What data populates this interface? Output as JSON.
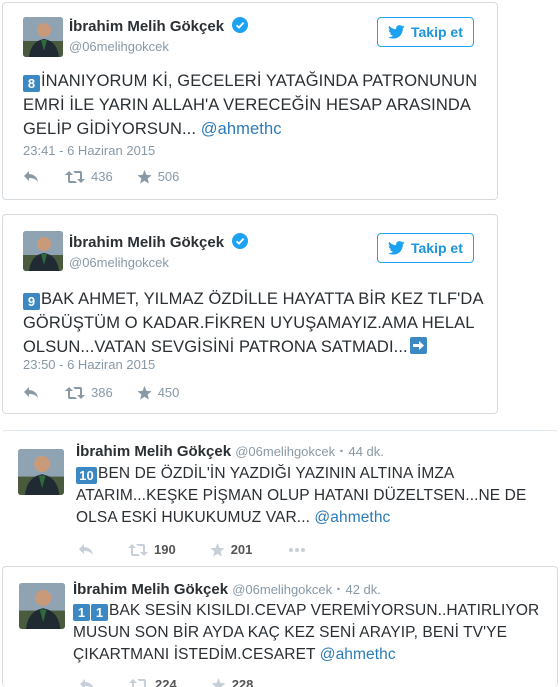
{
  "tweets": [
    {
      "name": "İbrahim Melih Gökçek",
      "handle": "@06melihgokcek",
      "follow_label": "Takip et",
      "keycap": "8",
      "text": "İNANIYORUM Kİ, GECELERİ YATAĞINDA PATRONUNUN EMRİ İLE YARIN ALLAH'A VERECEĞİN HESAP ARASINDA GELİP GİDİYORSUN... ",
      "mention": "@ahmethc",
      "timestamp": "23:41 - 6 Haziran 2015",
      "retweets": "436",
      "favorites": "506"
    },
    {
      "name": "İbrahim Melih Gökçek",
      "handle": "@06melihgokcek",
      "follow_label": "Takip et",
      "keycap": "9",
      "text": "BAK AHMET, YILMAZ ÖZDİLLE HAYATTA BİR KEZ TLF'DA GÖRÜŞTÜM O KADAR.FİKREN UYUŞAMAYIZ.AMA HELAL OLSUN...VATAN SEVGİSİNİ PATRONA SATMADI...",
      "timestamp": "23:50 - 6 Haziran 2015",
      "retweets": "386",
      "favorites": "450"
    },
    {
      "name": "İbrahim Melih Gökçek",
      "handle": "@06melihgokcek",
      "time_ago": "44 dk.",
      "keycap": "10",
      "text": "BEN DE ÖZDİL'İN YAZDIĞI YAZININ ALTINA İMZA ATARIM...KEŞKE PİŞMAN OLUP HATANI DÜZELTSEN...NE DE OLSA ESKİ HUKUKUMUZ VAR... ",
      "mention": "@ahmethc",
      "retweets": "190",
      "favorites": "201"
    },
    {
      "name": "İbrahim Melih Gökçek",
      "handle": "@06melihgokcek",
      "time_ago": "42 dk.",
      "keycap_a": "1",
      "keycap_b": "1",
      "text": "BAK SESİN KISILDI.CEVAP VEREMİYORSUN..HATIRLIYOR MUSUN SON BİR AYDA KAÇ KEZ SENİ ARAYIP, BENİ TV'YE ÇIKARTMANI İSTEDİM.CESARET ",
      "mention": "@ahmethc",
      "retweets": "224",
      "favorites": "228"
    }
  ],
  "colors": {
    "accent": "#1da1f2",
    "link": "#2b7bb9",
    "keycap": "#3b88c3",
    "muted": "#8899a6"
  },
  "icons": [
    "verified-badge-icon",
    "twitter-bird-icon",
    "reply-icon",
    "retweet-icon",
    "favorite-star-icon",
    "more-icon",
    "right-arrow-emoji-icon"
  ]
}
